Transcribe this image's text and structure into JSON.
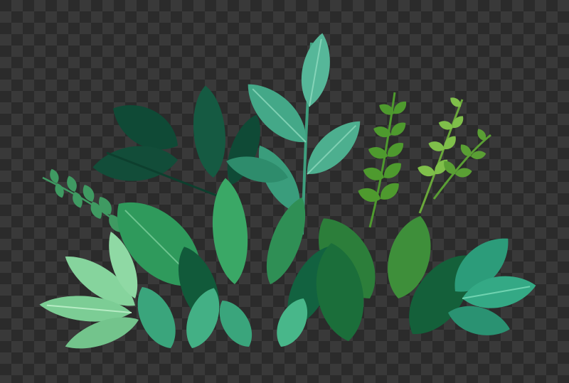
{
  "image": {
    "subject": "",
    "background": "transparency-checkerboard",
    "colors": {
      "checker_dark": "#2b2b2b",
      "checker_light": "#393939",
      "leaf_darkest": "#0f4a36",
      "leaf_dark": "#175f44",
      "leaf_mid": "#2a8a5c",
      "leaf_teal": "#3aa57c",
      "leaf_light": "#5fc08a",
      "leaf_pale": "#86d49d",
      "fern_olive": "#4e9a2e",
      "fern_lime": "#7fbf4a"
    }
  }
}
